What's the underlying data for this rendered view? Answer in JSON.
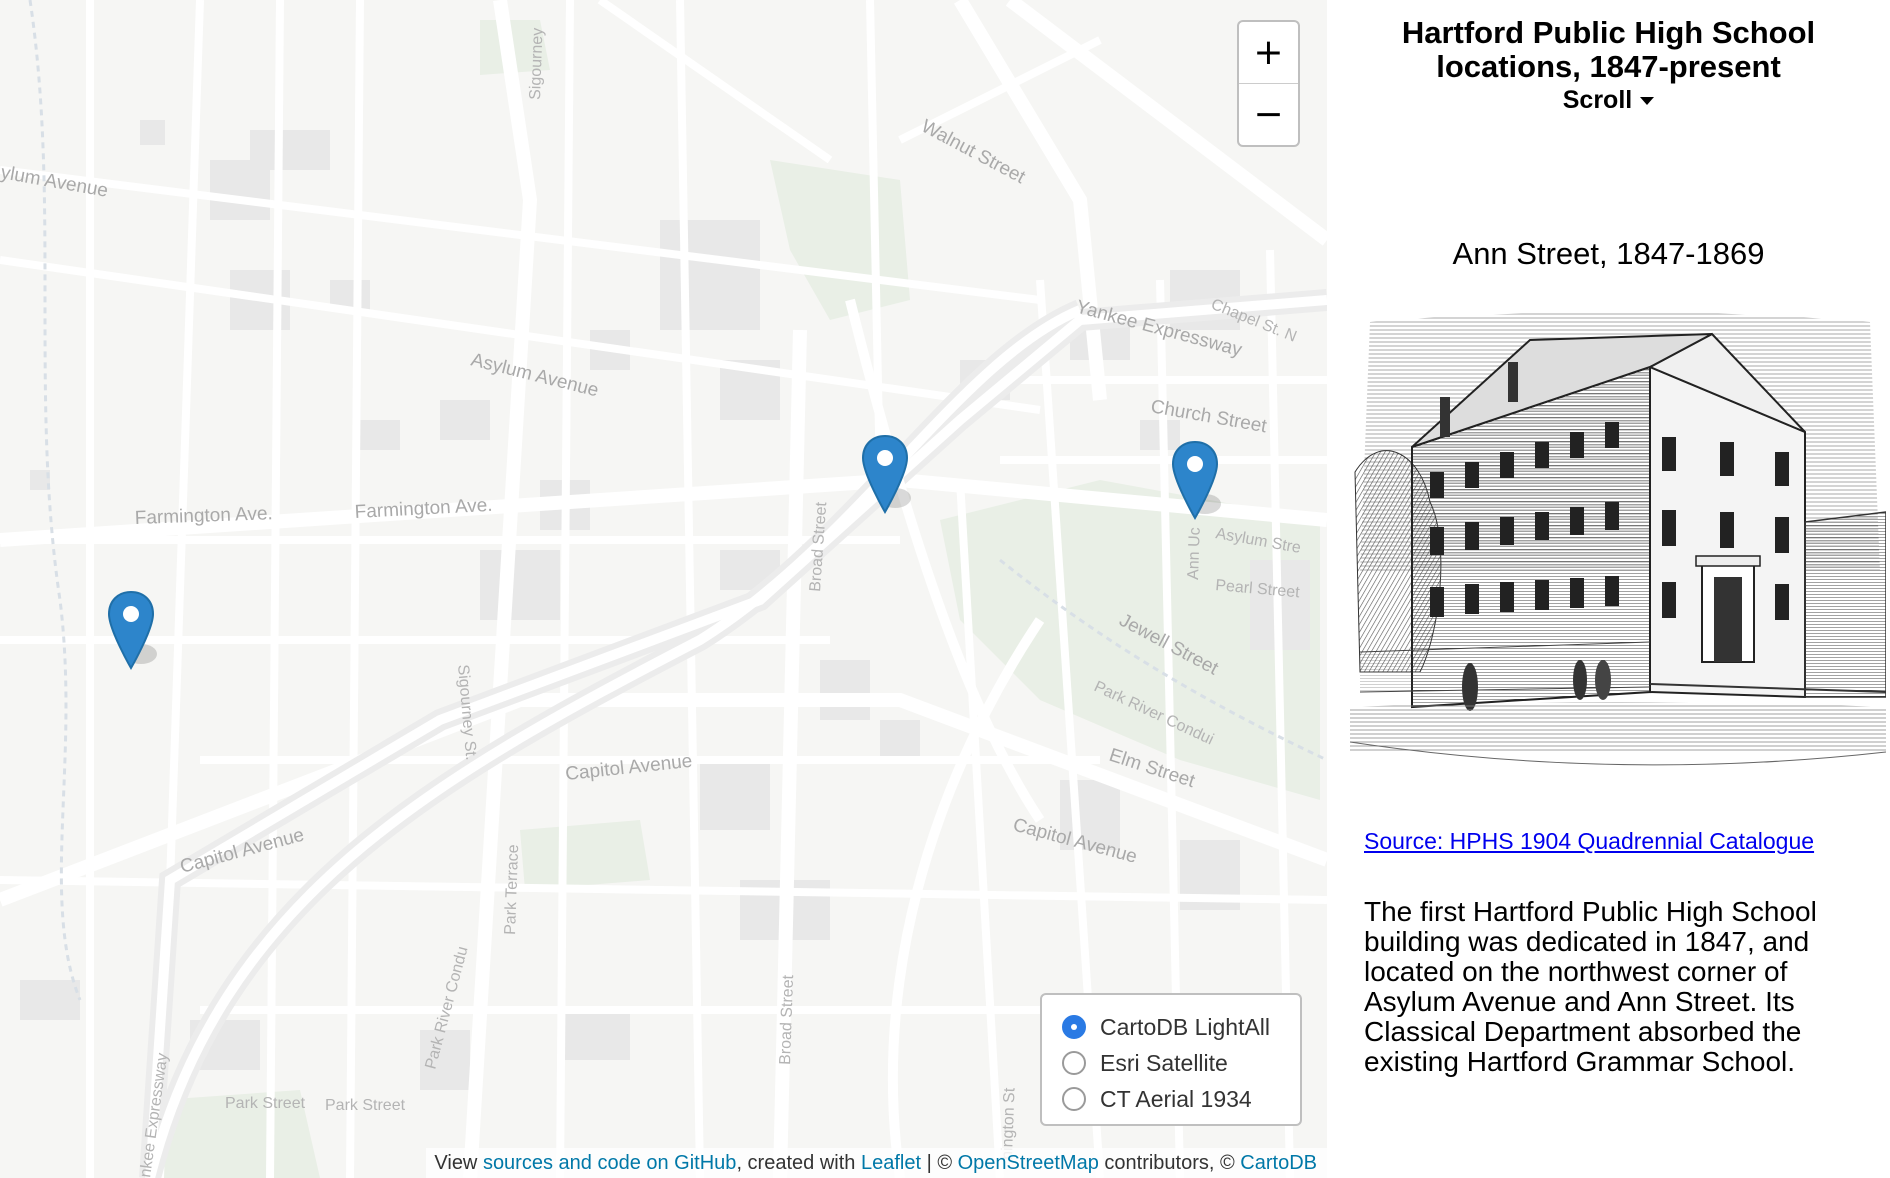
{
  "map": {
    "street_labels": [
      "ylum Avenue",
      "Walnut Street",
      "Yankee Expressway",
      "Chapel St. N",
      "Asylum Avenue",
      "Church Street",
      "Farmington Ave.",
      "Farmington Ave.",
      "Broad Street",
      "Asylum Stre",
      "Pearl Street",
      "Jewell Street",
      "Sigourney St.",
      "Sigourney",
      "Park River Condui",
      "Capitol Avenue",
      "Elm Street",
      "Capitol Avenue",
      "Capitol Avenue",
      "Park Terrace",
      "Park River Condu",
      "Broad Street",
      "Park Street",
      "Park Street",
      "Ann Uc",
      "nkee Expressway",
      "hington St"
    ],
    "marker_count": 3,
    "zoom_in_label": "+",
    "zoom_out_label": "−"
  },
  "layers": {
    "options": [
      "CartoDB LightAll",
      "Esri Satellite",
      "CT Aerial 1934"
    ],
    "selected": "CartoDB LightAll"
  },
  "attribution": {
    "prefix": "View ",
    "link1": "sources and code on GitHub",
    "mid1": ", created with ",
    "link2": "Leaflet",
    "mid2": " | © ",
    "link3": "OpenStreetMap",
    "mid3": " contributors, © ",
    "link4": "CartoDB"
  },
  "panel": {
    "title": "Hartford Public High School locations, 1847-present",
    "scroll_label": "Scroll",
    "location_heading": "Ann Street, 1847-1869",
    "source_link": "Source: HPHS 1904 Quadrennial Catalogue",
    "description": "The first Hartford Public High School building was dedicated in 1847, and located on the northwest corner of Asylum Avenue and Ann Street. Its Classical Department absorbed the existing Hartford Grammar School."
  },
  "colors": {
    "marker": "#2d85cb",
    "accent_link": "#0078a8",
    "radio_selected": "#2a7ae4"
  }
}
